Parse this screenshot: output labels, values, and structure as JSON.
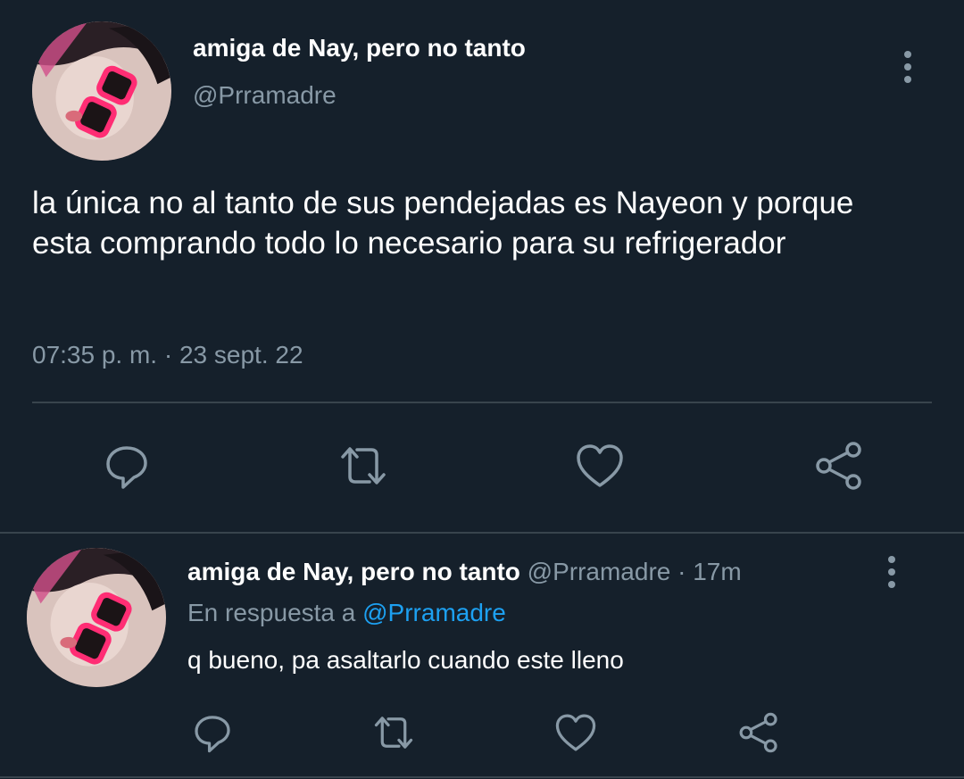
{
  "main_tweet": {
    "display_name": "amiga de Nay, pero no tanto",
    "handle": "@Prramadre",
    "text": "la única no al tanto de sus pendejadas es Nayeon y porque esta comprando todo lo necesario para su refrigerador",
    "timestamp": "07:35 p. m. · 23 sept. 22",
    "actions": [
      "reply-icon",
      "retweet-icon",
      "like-icon",
      "share-icon"
    ]
  },
  "reply_tweet": {
    "display_name": "amiga de Nay, pero no tanto",
    "handle": "@Prramadre",
    "separator": "·",
    "time_ago": "17m",
    "reply_prefix": "En respuesta a",
    "reply_to": "@Prramadre",
    "text": "q bueno, pa asaltarlo cuando este lleno",
    "actions": [
      "reply-icon",
      "retweet-icon",
      "like-icon",
      "share-icon"
    ]
  },
  "colors": {
    "background": "#15202b",
    "text": "#ffffff",
    "muted": "#8899a6",
    "link": "#1da1f2",
    "divider": "#38444d"
  }
}
